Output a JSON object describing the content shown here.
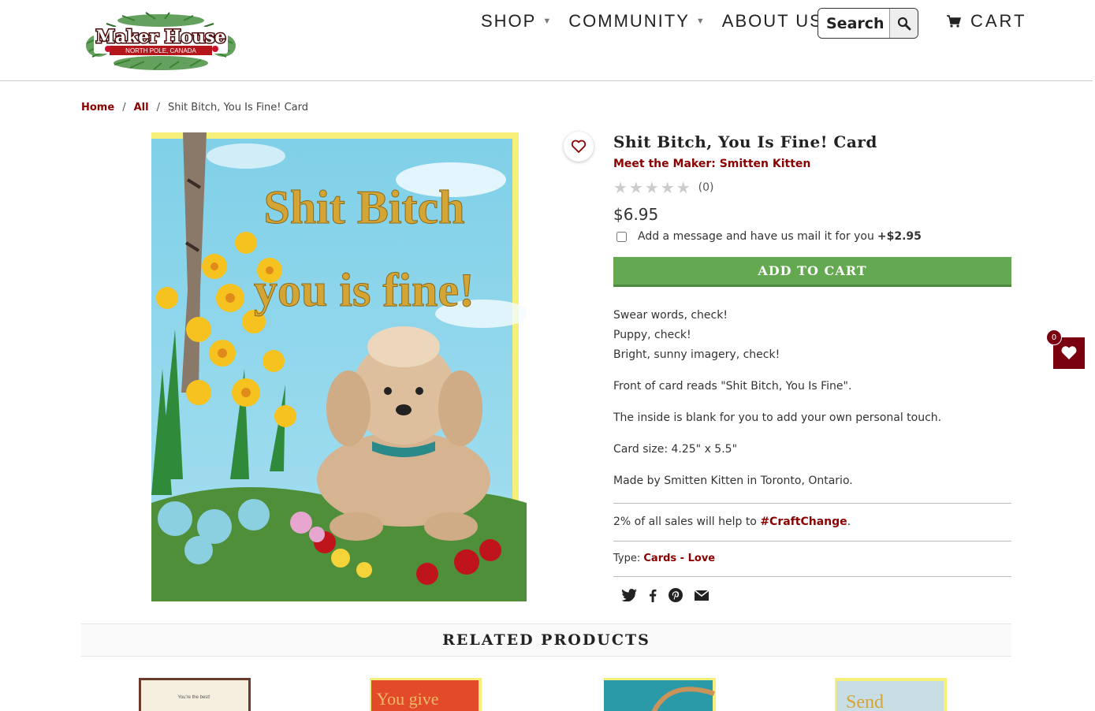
{
  "header": {
    "logo": {
      "title": "Maker House",
      "subtitle": "NORTH POLE, CANADA"
    },
    "nav": [
      {
        "label": "SHOP"
      },
      {
        "label": "COMMUNITY"
      },
      {
        "label": "ABOUT US"
      }
    ],
    "search": {
      "placeholder": "Search"
    },
    "cart_label": "CART"
  },
  "breadcrumb": {
    "home": "Home",
    "all": "All",
    "current": "Shit Bitch, You Is Fine! Card"
  },
  "product": {
    "image": {
      "line1": "Shit Bitch",
      "line2": "you is fine!"
    },
    "title": "Shit Bitch, You Is Fine! Card",
    "maker_link": "Meet the Maker: Smitten Kitten",
    "rating": {
      "stars": 0,
      "count_label": "(0)"
    },
    "price": "$6.95",
    "addon": {
      "label": "Add a message and have us mail it for you",
      "price": "+$2.95",
      "checked": false
    },
    "add_to_cart": "ADD TO CART",
    "description": {
      "line1": "Swear words, check!",
      "line2": "Puppy, check!",
      "line3": "Bright, sunny imagery, check!",
      "p2": "Front of card reads \"Shit Bitch, You Is Fine\".",
      "p3": "The inside is blank for you to add your own personal touch.",
      "p4": "Card size: 4.25\" x 5.5\"",
      "p5": "Made by Smitten Kitten in Toronto, Ontario."
    },
    "craft": {
      "prefix": "2% of all sales will help to",
      "link": "#CraftChange",
      "suffix": "."
    },
    "type": {
      "label": "Type:",
      "value": "Cards - Love"
    },
    "share": [
      "twitter-icon",
      "facebook-icon",
      "pinterest-icon",
      "email-icon"
    ]
  },
  "related": {
    "heading": "RELATED PRODUCTS",
    "items": [
      {
        "caption": "You're the best!"
      },
      {
        "caption": "You give"
      },
      {
        "caption": ""
      },
      {
        "caption": "Send"
      }
    ]
  },
  "wishlist": {
    "count": "0"
  },
  "colors": {
    "brand_red": "#8b0000",
    "cart_green": "#64a852",
    "wish_red": "#7a0010"
  }
}
